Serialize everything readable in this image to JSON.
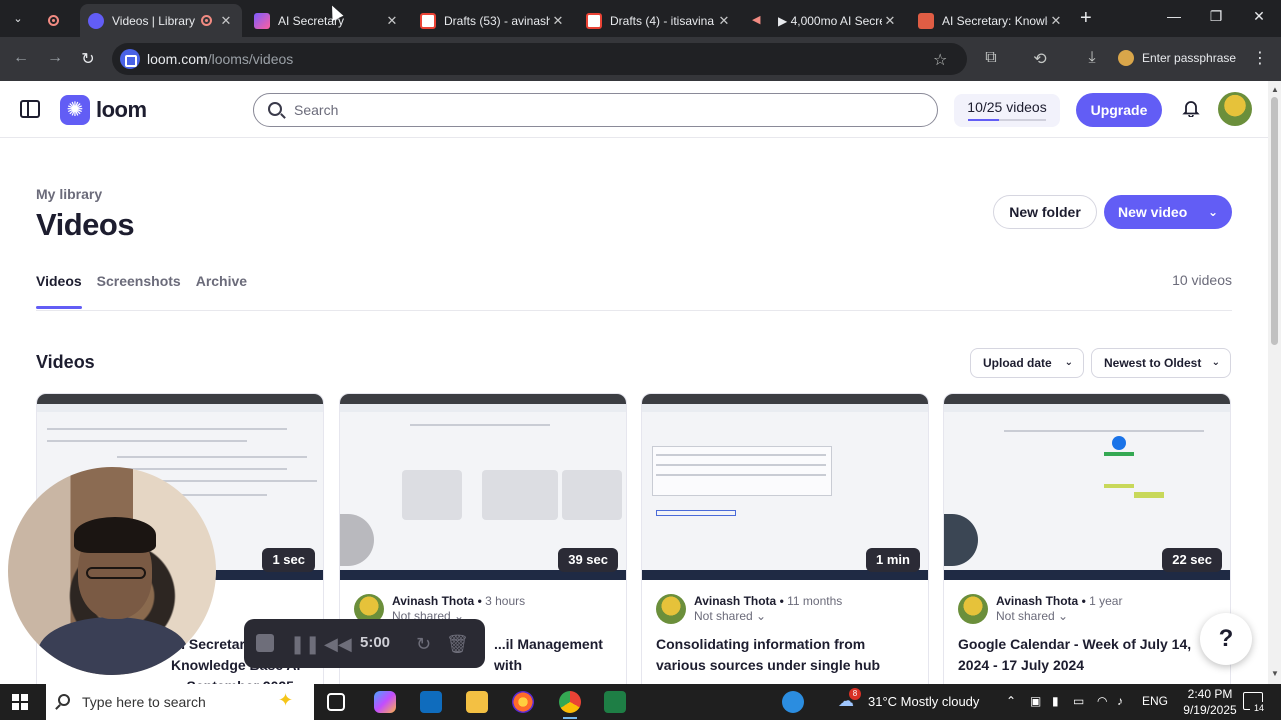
{
  "browser": {
    "tabs": [
      {
        "label": "",
        "icon": "record-icon",
        "color": "#f28b82"
      },
      {
        "label": "Videos | Library",
        "icon": "loom-icon",
        "color": "#625df5",
        "active": true
      },
      {
        "label": "AI Secretary",
        "icon": "app-icon",
        "color": "#c04cc2"
      },
      {
        "label": "Drafts (53) - avinash",
        "icon": "gmail-icon",
        "color": "#ea4335"
      },
      {
        "label": "Drafts (4) - itisavina",
        "icon": "gmail-icon",
        "color": "#ea4335"
      },
      {
        "label": "▶ 4,000mo AI Secret",
        "icon": "sound-icon",
        "color": "#f28b82"
      },
      {
        "label": "AI Secretary: Knowle",
        "icon": "ai-icon",
        "color": "#e05d44"
      }
    ],
    "url_host": "loom.com",
    "url_path": "/looms/videos",
    "profile_label": "Enter passphrase"
  },
  "header": {
    "brand": "loom",
    "search_placeholder": "Search",
    "quota_text": "10/25 videos",
    "quota_fraction": 0.4,
    "upgrade_label": "Upgrade"
  },
  "library": {
    "crumb": "My library",
    "title": "Videos",
    "new_folder": "New folder",
    "new_video": "New video",
    "tabs": [
      "Videos",
      "Screenshots",
      "Archive"
    ],
    "count": "10 videos",
    "section_title": "Videos",
    "sort_field": "Upload date",
    "sort_order": "Newest to Oldest"
  },
  "cards": [
    {
      "duration": "1 sec",
      "author": "",
      "when": "",
      "share": "",
      "title": "AI Secretary: Knowledge Base\nAI ... September 2025"
    },
    {
      "duration": "39 sec",
      "author": "Avinash Thota",
      "when": "3 hours",
      "share": "Not shared",
      "title": "...il Management with"
    },
    {
      "duration": "1 min",
      "author": "Avinash Thota",
      "when": "11 months",
      "share": "Not shared",
      "title": "Consolidating information from various sources under single hub"
    },
    {
      "duration": "22 sec",
      "author": "Avinash Thota",
      "when": "1 year",
      "share": "Not shared",
      "title": "Google Calendar - Week of July 14, 2024 - 17 July 2024"
    }
  ],
  "recorder": {
    "time": "5:00"
  },
  "help_label": "?",
  "taskbar": {
    "search_text": "Type here to search",
    "weather": "31°C  Mostly cloudy",
    "weather_badge": "8",
    "lang": "ENG",
    "time": "2:40 PM",
    "date": "9/19/2025",
    "notifications": "14"
  }
}
